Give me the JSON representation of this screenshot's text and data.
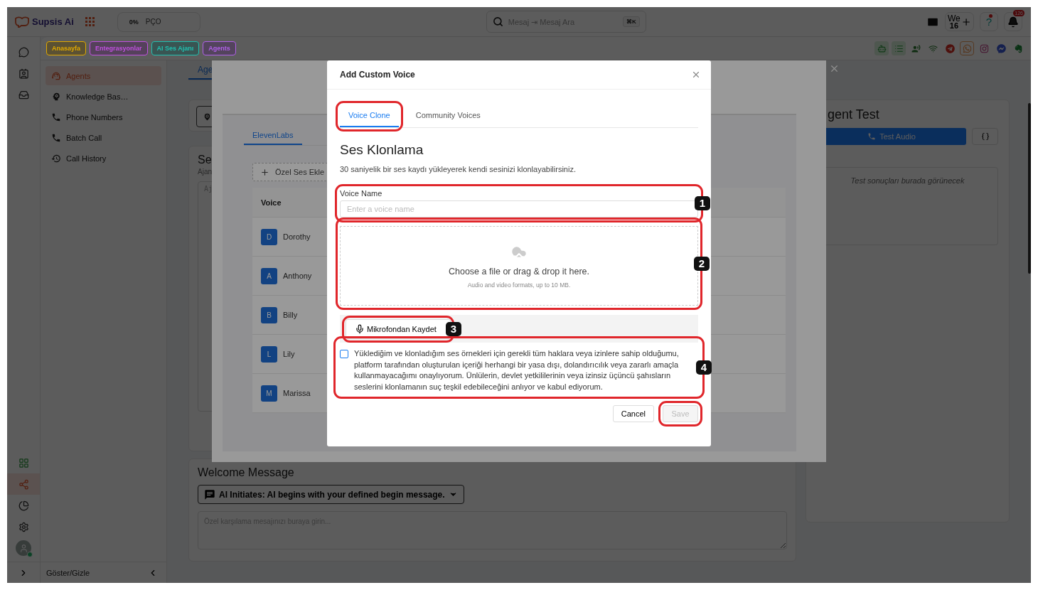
{
  "topbar": {
    "logo": "Supsis Ai",
    "stat": {
      "value": "0%",
      "label": "PÇO"
    },
    "search": {
      "placeholder": "Mesaj ⇥ Mesaj Ara",
      "shortcut": "⌘K"
    },
    "workspace": {
      "code": "We",
      "count": "16"
    },
    "help": "?",
    "notifications": "126"
  },
  "tags": [
    {
      "label": "Anasayfa",
      "color": "#e0a800"
    },
    {
      "label": "Entegrasyonlar",
      "color": "#c050e0"
    },
    {
      "label": "AI Ses Ajanı",
      "color": "#20c0b0"
    },
    {
      "label": "Agents",
      "color": "#b060e8"
    }
  ],
  "channels": [
    {
      "active": true,
      "selected": false
    },
    {
      "active": true,
      "selected": false
    },
    {
      "active": false,
      "selected": false
    },
    {
      "active": false,
      "selected": false
    },
    {
      "active": false,
      "selected": false
    },
    {
      "active": false,
      "selected": true
    },
    {
      "active": false,
      "selected": false
    },
    {
      "active": false,
      "selected": false
    },
    {
      "active": false,
      "selected": false
    }
  ],
  "rail": {
    "top": [
      {
        "selected": false
      },
      {
        "selected": false
      },
      {
        "selected": false
      }
    ],
    "bottom": [
      {
        "selected": false
      },
      {
        "selected": true
      },
      {
        "selected": false
      },
      {
        "selected": false
      }
    ],
    "avatar": {
      "online": true
    }
  },
  "sidebar": {
    "items": [
      {
        "label": "Agents",
        "selected": true
      },
      {
        "label": "Knowledge Bas…",
        "selected": false
      },
      {
        "label": "Phone Numbers",
        "selected": false
      },
      {
        "label": "Batch Call",
        "selected": false
      },
      {
        "label": "Call History",
        "selected": false
      }
    ],
    "toggle": "Göster/Gizle"
  },
  "main": {
    "tabs": [
      {
        "label": "Age",
        "selected": true
      }
    ],
    "section": {
      "title": "Se",
      "subtitle": "Ajan",
      "placeholder": "Aj"
    },
    "welcome": {
      "title": "Welcome Message",
      "mode": "AI Initiates: AI begins with your defined begin message.",
      "placeholder": "Özel karşılama mesajınızı buraya girin..."
    }
  },
  "test_panel": {
    "title": "gent Test",
    "button": "Test Audio",
    "placeholder": "Test sonuçları burada görünecek"
  },
  "drawer": {
    "tabs": [
      {
        "label": "ElevenLabs",
        "selected": true
      }
    ],
    "add_button": "Özel Ses Ekle",
    "table": {
      "columns": [
        "Voice"
      ],
      "rows": [
        {
          "initial": "D",
          "name": "Dorothy"
        },
        {
          "initial": "A",
          "name": "Anthony"
        },
        {
          "initial": "B",
          "name": "Billy"
        },
        {
          "initial": "L",
          "name": "Lily"
        },
        {
          "initial": "M",
          "name": "Marissa"
        }
      ]
    }
  },
  "modal": {
    "title": "Add Custom Voice",
    "tabs": [
      {
        "label": "Voice Clone",
        "selected": true,
        "highlighted": true
      },
      {
        "label": "Community Voices",
        "selected": false,
        "highlighted": false
      }
    ],
    "heading": "Ses Klonlama",
    "description": "30 saniyelik bir ses kaydı yükleyerek kendi sesinizi klonlayabilirsiniz.",
    "voice_name": {
      "label": "Voice Name",
      "placeholder": "Enter a voice name",
      "marker": "1"
    },
    "dropzone": {
      "title": "Choose a file or drag & drop it here.",
      "hint": "Audio and video formats, up to 10 MB.",
      "marker": "2"
    },
    "record_button": {
      "label": "Mikrofondan Kaydet",
      "marker": "3"
    },
    "consent": {
      "checked": false,
      "text": "Yüklediğim ve klonladığım ses örnekleri için gerekli tüm haklara veya izinlere sahip olduğumu, platform tarafından oluşturulan içeriği herhangi bir yasa dışı, dolandırıcılık veya zararlı amaçla kullanmayacağımı onaylıyorum. Ünlülerin, devlet yetkililerinin veya izinsiz üçüncü şahısların seslerini klonlamanın suç teşkil edebileceğini anlıyor ve kabul ediyorum.",
      "marker": "4"
    },
    "cancel": "Cancel",
    "save": {
      "label": "Save",
      "disabled": true,
      "highlighted": true
    }
  }
}
